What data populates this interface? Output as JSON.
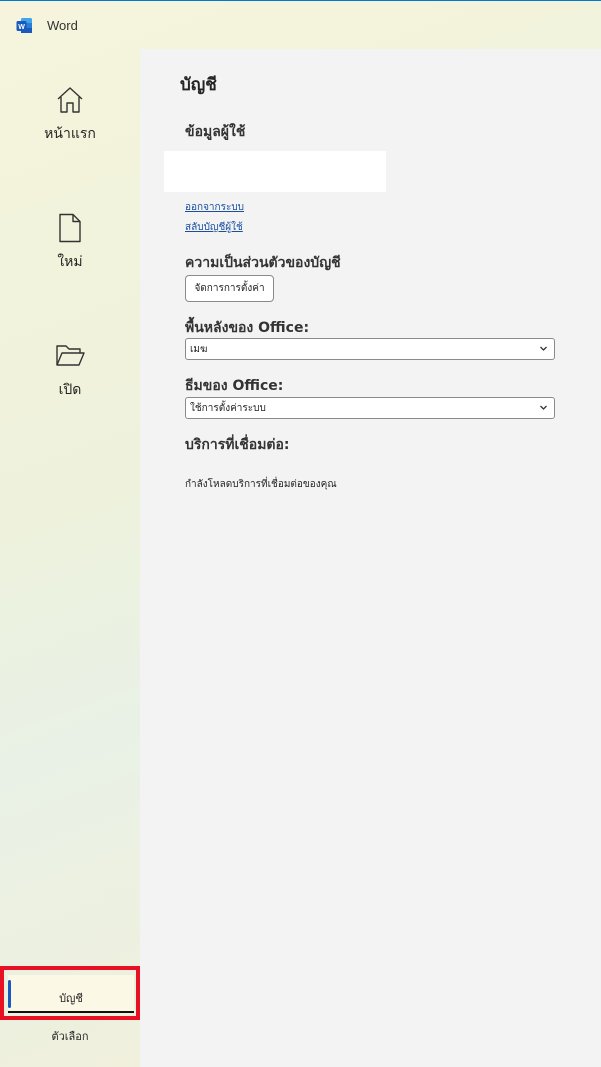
{
  "app": {
    "title": "Word",
    "icon": "word-icon",
    "brand_color": "#185abd"
  },
  "nav": {
    "items": [
      {
        "label": "หน้าแรก",
        "icon": "home-icon"
      },
      {
        "label": "ใหม่",
        "icon": "new-document-icon"
      },
      {
        "label": "เปิด",
        "icon": "folder-open-icon"
      }
    ],
    "account": {
      "label": "บัญชี",
      "selected": true
    },
    "options": {
      "label": "ตัวเลือก"
    },
    "highlight_color": "#e81123"
  },
  "content": {
    "title": "บัญชี",
    "user_info": {
      "heading": "ข้อมูลผู้ใช้",
      "sign_out": "ออกจากระบบ",
      "switch_account": "สลับบัญชีผู้ใช้"
    },
    "privacy": {
      "heading": "ความเป็นส่วนตัวของบัญชี",
      "button": "จัดการการตั้งค่า"
    },
    "background": {
      "heading": "พื้นหลังของ Office:",
      "selected": "เมฆ"
    },
    "theme": {
      "heading": "ธีมของ Office:",
      "selected": "ใช้การตั้งค่าระบบ"
    },
    "services": {
      "heading": "บริการที่เชื่อมต่อ:",
      "status": "กำลังโหลดบริการที่เชื่อมต่อของคุณ"
    }
  }
}
